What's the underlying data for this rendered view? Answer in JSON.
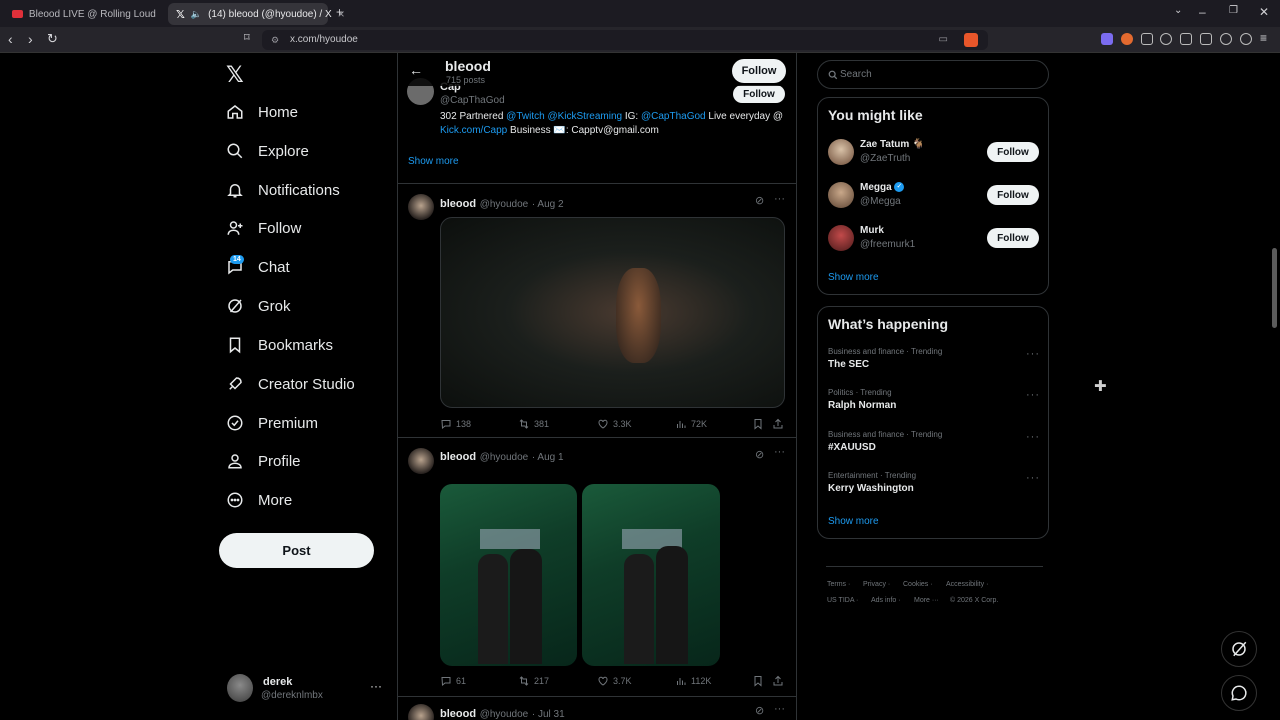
{
  "browser": {
    "tabs": [
      {
        "title": "Bleood LIVE @ Rolling Loud Orlando",
        "icon": "youtube-icon"
      },
      {
        "title": "(14) bleood (@hyoudoe) / X",
        "icon": "x-icon"
      }
    ],
    "url": "x.com/hyoudoe"
  },
  "left_nav": {
    "items": [
      {
        "label": "Home",
        "icon": "home-icon"
      },
      {
        "label": "Explore",
        "icon": "search-icon"
      },
      {
        "label": "Notifications",
        "icon": "bell-icon"
      },
      {
        "label": "Follow",
        "icon": "person-add-icon"
      },
      {
        "label": "Chat",
        "icon": "chat-icon"
      },
      {
        "label": "Grok",
        "icon": "grok-icon"
      },
      {
        "label": "Bookmarks",
        "icon": "bookmark-icon"
      },
      {
        "label": "Creator Studio",
        "icon": "rocket-icon"
      },
      {
        "label": "Premium",
        "icon": "verified-icon"
      },
      {
        "label": "Profile",
        "icon": "person-icon"
      },
      {
        "label": "More",
        "icon": "more-circle-icon"
      }
    ],
    "chat_badge": "14",
    "post_label": "Post",
    "account": {
      "name": "derek",
      "handle": "@dereknlmbx"
    }
  },
  "header": {
    "name": "bleood",
    "posts": "715 posts",
    "follow_label": "Follow"
  },
  "pinned_user": {
    "name": "Cap",
    "handle": "@CapThaGod",
    "follow_label": "Follow",
    "bio_plain_1": "302 Partnered ",
    "bio_link_1": "@Twitch",
    "bio_link_2": "@KickStreaming",
    "bio_plain_2": " IG: ",
    "bio_link_3": "@CapThaGod",
    "bio_plain_3": " Live everyday @",
    "bio_link_4": "Kick.com/Capp",
    "bio_plain_4": " Business ✉️: Capptv@gmail.com",
    "show_more": "Show more"
  },
  "tweets": [
    {
      "name": "bleood",
      "handle": "@hyoudoe",
      "date": "· Aug 2",
      "replies": "138",
      "reposts": "381",
      "likes": "3.3K",
      "views": "72K"
    },
    {
      "name": "bleood",
      "handle": "@hyoudoe",
      "date": "· Aug 1",
      "replies": "61",
      "reposts": "217",
      "likes": "3.7K",
      "views": "112K"
    },
    {
      "name": "bleood",
      "handle": "@hyoudoe",
      "date": "· Jul 31"
    }
  ],
  "search": {
    "placeholder": "Search"
  },
  "you_might_like": {
    "title": "You might like",
    "users": [
      {
        "name": "Zae Tatum 🐐",
        "handle": "@ZaeTruth",
        "follow": "Follow"
      },
      {
        "name": "Megga",
        "handle": "@Megga",
        "follow": "Follow"
      },
      {
        "name": "Murk",
        "handle": "@freemurk1",
        "follow": "Follow"
      }
    ],
    "show_more": "Show more"
  },
  "whats_happening": {
    "title": "What’s happening",
    "trends": [
      {
        "category": "Business and finance · Trending",
        "name": "The SEC"
      },
      {
        "category": "Politics · Trending",
        "name": "Ralph Norman"
      },
      {
        "category": "Business and finance · Trending",
        "name": "#XAUUSD"
      },
      {
        "category": "Entertainment · Trending",
        "name": "Kerry Washington"
      }
    ],
    "show_more": "Show more"
  },
  "footer": {
    "terms": "Terms ·",
    "privacy": "Privacy ·",
    "cookies": "Cookies ·",
    "accessibility": "Accessibility ·",
    "tida": "US TIDA ·",
    "ads": "Ads info ·",
    "more": "More ···",
    "copyright": "© 2026 X Corp."
  }
}
